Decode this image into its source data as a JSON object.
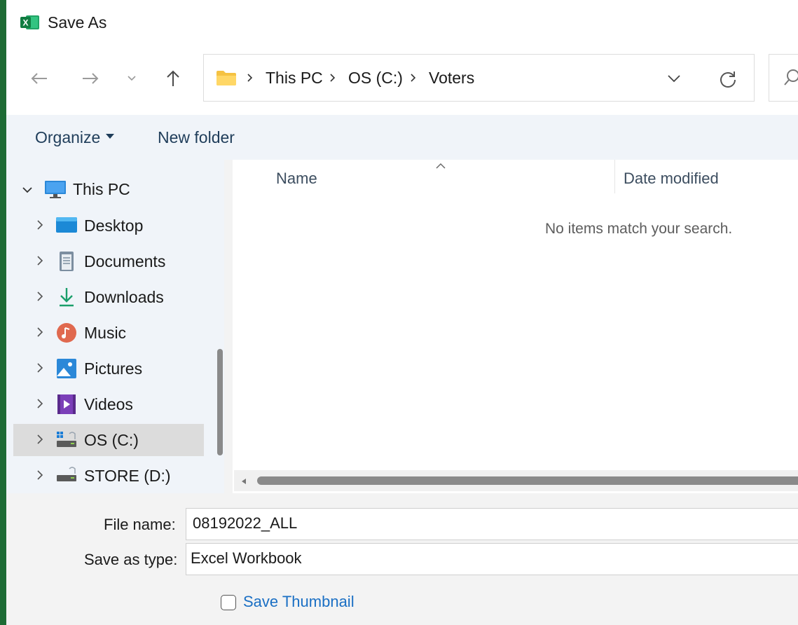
{
  "window": {
    "title": "Save As",
    "app_icon": "excel-icon"
  },
  "navigation": {
    "back_icon": "arrow-left-icon",
    "forward_icon": "arrow-right-icon",
    "recent_icon": "chevron-down-icon",
    "up_icon": "arrow-up-icon"
  },
  "address_bar": {
    "folder_icon": "folder-icon",
    "breadcrumbs": [
      "This PC",
      "OS (C:)",
      "Voters"
    ],
    "dropdown_icon": "chevron-down-icon",
    "refresh_icon": "refresh-icon"
  },
  "search": {
    "icon": "search-icon"
  },
  "toolbar": {
    "organize_label": "Organize",
    "new_folder_label": "New folder"
  },
  "nav_pane": {
    "root": {
      "label": "This PC",
      "icon": "monitor-icon",
      "expanded": true
    },
    "items": [
      {
        "label": "Desktop",
        "icon": "desktop-icon"
      },
      {
        "label": "Documents",
        "icon": "documents-icon"
      },
      {
        "label": "Downloads",
        "icon": "download-icon"
      },
      {
        "label": "Music",
        "icon": "music-icon"
      },
      {
        "label": "Pictures",
        "icon": "pictures-icon"
      },
      {
        "label": "Videos",
        "icon": "videos-icon"
      },
      {
        "label": "OS (C:)",
        "icon": "windows-drive-icon",
        "selected": true
      },
      {
        "label": "STORE (D:)",
        "icon": "drive-icon"
      }
    ]
  },
  "file_list": {
    "columns": [
      "Name",
      "Date modified"
    ],
    "sort_icon": "sort-up-icon",
    "empty_message": "No items match your search."
  },
  "form": {
    "file_name_label": "File name:",
    "file_name_value": "08192022_ALL",
    "save_type_label": "Save as type:",
    "save_type_value": "Excel Workbook",
    "thumbnail_label": "Save Thumbnail",
    "thumbnail_checked": false
  },
  "colors": {
    "accent_green": "#1e6b35",
    "link_blue": "#1a6fc4",
    "pane_background": "#f0f4f9"
  }
}
